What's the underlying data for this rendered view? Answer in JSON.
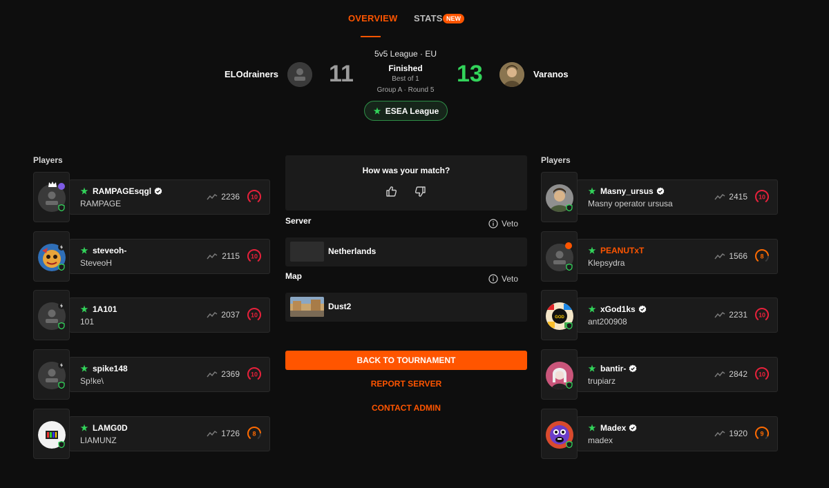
{
  "tabs": {
    "overview": "OVERVIEW",
    "stats": "STATS",
    "new_badge": "NEW"
  },
  "match": {
    "league": "5v5 League · EU",
    "status": "Finished",
    "best_of": "Best of 1",
    "group_round": "Group A · Round 5",
    "competition": "ESEA League",
    "team_left": {
      "name": "ELOdrainers",
      "score": "11"
    },
    "team_right": {
      "name": "Varanos",
      "score": "13"
    }
  },
  "colors": {
    "accent": "#ff5500",
    "win": "#32d35a",
    "lose": "#9c9c9c",
    "level_10": "#e8203a",
    "level_8": "#ff6a00",
    "level_9": "#ff6a00",
    "verified": "#ffffff",
    "shield": "#32d35a"
  },
  "left_team": {
    "section_title": "Players",
    "players": [
      {
        "nick": "RAMPAGEsqgl",
        "name": "RAMPAGE",
        "elo": "2236",
        "level": "10",
        "verified": true,
        "avatar": "default",
        "crown": true,
        "badge": "purple-star"
      },
      {
        "nick": "steveoh-",
        "name": "SteveoH",
        "elo": "2115",
        "level": "10",
        "verified": false,
        "avatar": "colorful",
        "badge": "bolt"
      },
      {
        "nick": "1A101",
        "name": "101",
        "elo": "2037",
        "level": "10",
        "verified": false,
        "avatar": "default",
        "badge": "bolt"
      },
      {
        "nick": "spike148",
        "name": "Sp!ke\\",
        "elo": "2369",
        "level": "10",
        "verified": false,
        "avatar": "default",
        "badge": "bolt"
      },
      {
        "nick": "LAMG0D",
        "name": "LIAMUNZ",
        "elo": "1726",
        "level": "8",
        "verified": false,
        "avatar": "white-logo",
        "badge": "none"
      }
    ]
  },
  "right_team": {
    "section_title": "Players",
    "players": [
      {
        "nick": "Masny_ursus",
        "name": "Masny operator ursusa",
        "elo": "2415",
        "level": "10",
        "verified": true,
        "avatar": "photo",
        "crown": false,
        "badge": "none"
      },
      {
        "nick": "PEANUTxT",
        "name": "Klepsydra",
        "elo": "1566",
        "level": "8",
        "verified": false,
        "avatar": "default",
        "badge": "orange-star",
        "nick_orange": true
      },
      {
        "nick": "xGod1ks",
        "name": "ant200908",
        "elo": "2231",
        "level": "10",
        "verified": true,
        "avatar": "stickers",
        "badge": "none"
      },
      {
        "nick": "bantir-",
        "name": "trupiarz",
        "elo": "2842",
        "level": "10",
        "verified": true,
        "avatar": "pink",
        "badge": "none"
      },
      {
        "nick": "Madex",
        "name": "madex",
        "elo": "1920",
        "level": "9",
        "verified": true,
        "avatar": "purple",
        "badge": "none"
      }
    ]
  },
  "center": {
    "feedback_question": "How was your match?",
    "server_label": "Server",
    "server_value": "Netherlands",
    "map_label": "Map",
    "map_value": "Dust2",
    "veto_label": "Veto",
    "back_button": "BACK TO TOURNAMENT",
    "report_link": "REPORT SERVER",
    "contact_link": "CONTACT ADMIN"
  }
}
